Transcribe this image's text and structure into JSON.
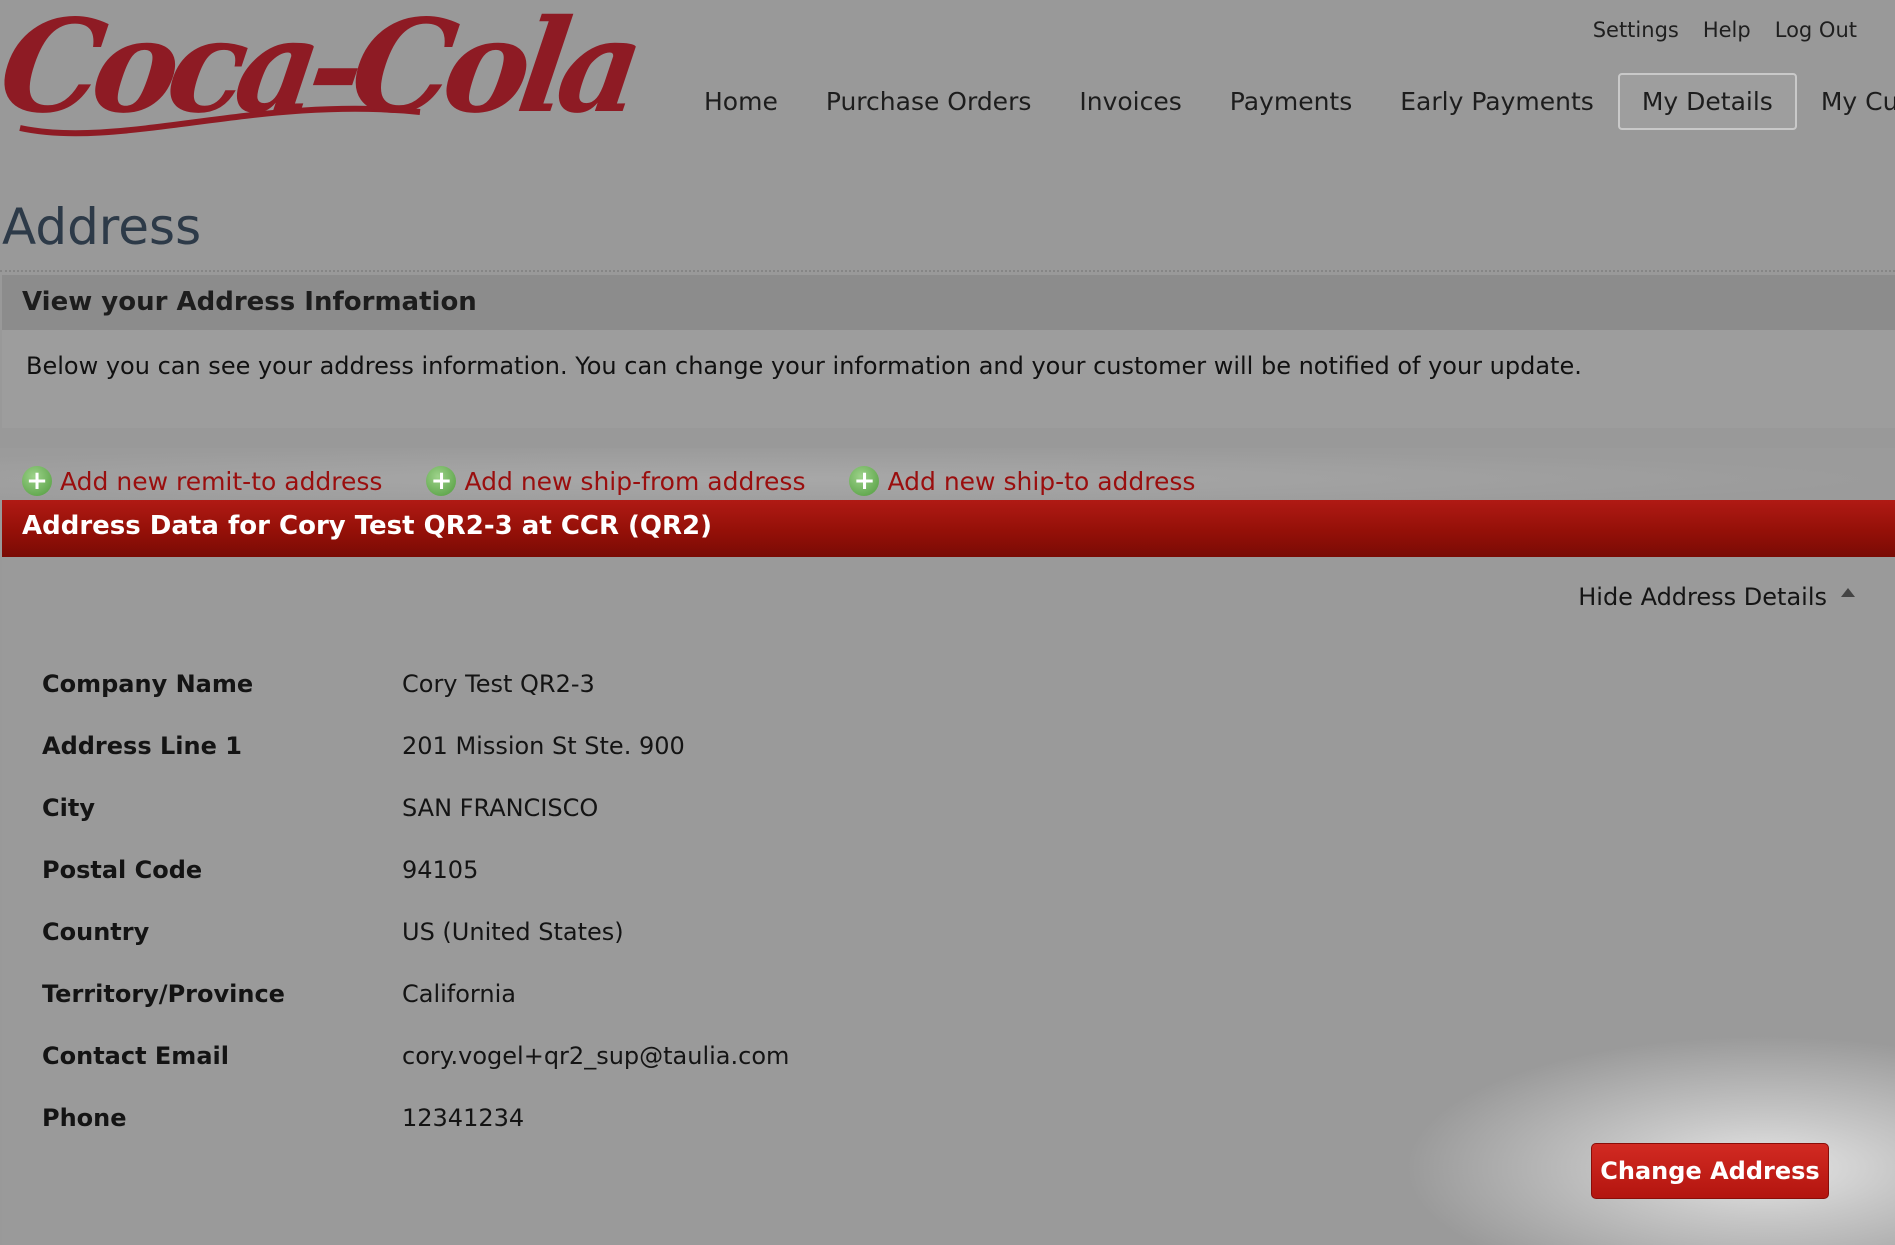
{
  "brand": {
    "logo_text": "Coca-Cola",
    "logo_color": "#8e1b24"
  },
  "utility_nav": [
    {
      "label": "Settings"
    },
    {
      "label": "Help"
    },
    {
      "label": "Log Out"
    }
  ],
  "main_nav": [
    {
      "label": "Home",
      "active": false
    },
    {
      "label": "Purchase Orders",
      "active": false
    },
    {
      "label": "Invoices",
      "active": false
    },
    {
      "label": "Payments",
      "active": false
    },
    {
      "label": "Early Payments",
      "active": false
    },
    {
      "label": "My Details",
      "active": true
    },
    {
      "label": "My Customer",
      "active": false
    }
  ],
  "page": {
    "title": "Address",
    "info_header": "View your Address Information",
    "info_body": "Below you can see your address information. You can change your information and your customer will be notified of your update."
  },
  "add_links": [
    {
      "label": "Add new remit-to address",
      "icon": "plus-circle-icon"
    },
    {
      "label": "Add new ship-from address",
      "icon": "plus-circle-icon"
    },
    {
      "label": "Add new ship-to address",
      "icon": "plus-circle-icon"
    }
  ],
  "address_section": {
    "header": "Address Data for Cory Test QR2-3 at CCR (QR2)",
    "toggle_label": "Hide Address Details",
    "rows": [
      {
        "label": "Company Name",
        "value": "Cory Test QR2-3"
      },
      {
        "label": "Address Line 1",
        "value": "201 Mission St Ste. 900"
      },
      {
        "label": "City",
        "value": "SAN FRANCISCO"
      },
      {
        "label": "Postal Code",
        "value": "94105"
      },
      {
        "label": "Country",
        "value": "US (United States)"
      },
      {
        "label": "Territory/Province",
        "value": "California"
      },
      {
        "label": "Contact Email",
        "value": "cory.vogel+qr2_sup@taulia.com"
      },
      {
        "label": "Phone",
        "value": "12341234"
      }
    ],
    "change_button": "Change Address"
  },
  "colors": {
    "accent_red": "#9a0e0e",
    "band_red": "#941008",
    "button_red": "#c41e17",
    "background": "#999999"
  }
}
